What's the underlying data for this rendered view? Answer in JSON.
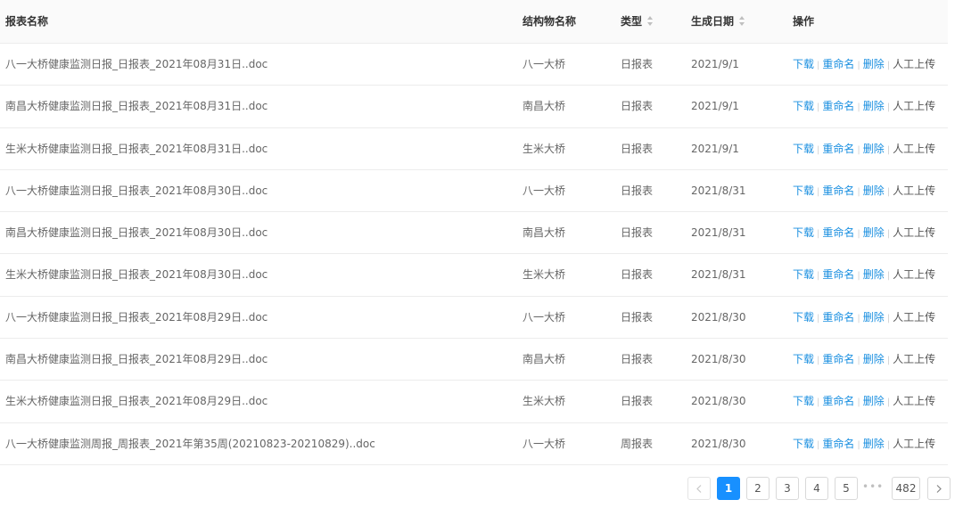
{
  "table": {
    "headers": {
      "name": "报表名称",
      "structure": "结构物名称",
      "type": "类型",
      "date": "生成日期",
      "ops": "操作"
    },
    "rows": [
      {
        "name": "八一大桥健康监测日报_日报表_2021年08月31日..doc",
        "structure": "八一大桥",
        "type": "日报表",
        "date": "2021/9/1"
      },
      {
        "name": "南昌大桥健康监测日报_日报表_2021年08月31日..doc",
        "structure": "南昌大桥",
        "type": "日报表",
        "date": "2021/9/1"
      },
      {
        "name": "生米大桥健康监测日报_日报表_2021年08月31日..doc",
        "structure": "生米大桥",
        "type": "日报表",
        "date": "2021/9/1"
      },
      {
        "name": "八一大桥健康监测日报_日报表_2021年08月30日..doc",
        "structure": "八一大桥",
        "type": "日报表",
        "date": "2021/8/31"
      },
      {
        "name": "南昌大桥健康监测日报_日报表_2021年08月30日..doc",
        "structure": "南昌大桥",
        "type": "日报表",
        "date": "2021/8/31"
      },
      {
        "name": "生米大桥健康监测日报_日报表_2021年08月30日..doc",
        "structure": "生米大桥",
        "type": "日报表",
        "date": "2021/8/31"
      },
      {
        "name": "八一大桥健康监测日报_日报表_2021年08月29日..doc",
        "structure": "八一大桥",
        "type": "日报表",
        "date": "2021/8/30"
      },
      {
        "name": "南昌大桥健康监测日报_日报表_2021年08月29日..doc",
        "structure": "南昌大桥",
        "type": "日报表",
        "date": "2021/8/30"
      },
      {
        "name": "生米大桥健康监测日报_日报表_2021年08月29日..doc",
        "structure": "生米大桥",
        "type": "日报表",
        "date": "2021/8/30"
      },
      {
        "name": "八一大桥健康监测周报_周报表_2021年第35周(20210823-20210829)..doc",
        "structure": "八一大桥",
        "type": "周报表",
        "date": "2021/8/30"
      }
    ],
    "actions": {
      "download": "下载",
      "rename": "重命名",
      "delete": "删除",
      "manual_upload": "人工上传"
    }
  },
  "pagination": {
    "pages": [
      "1",
      "2",
      "3",
      "4",
      "5"
    ],
    "current": "1",
    "ellipsis": "•••",
    "last": "482",
    "prev_icon": "chevron-left-icon",
    "next_icon": "chevron-right-icon"
  },
  "colors": {
    "link": "#1a8fe0",
    "active_page": "#1890ff",
    "header_bg": "#fafafa"
  }
}
